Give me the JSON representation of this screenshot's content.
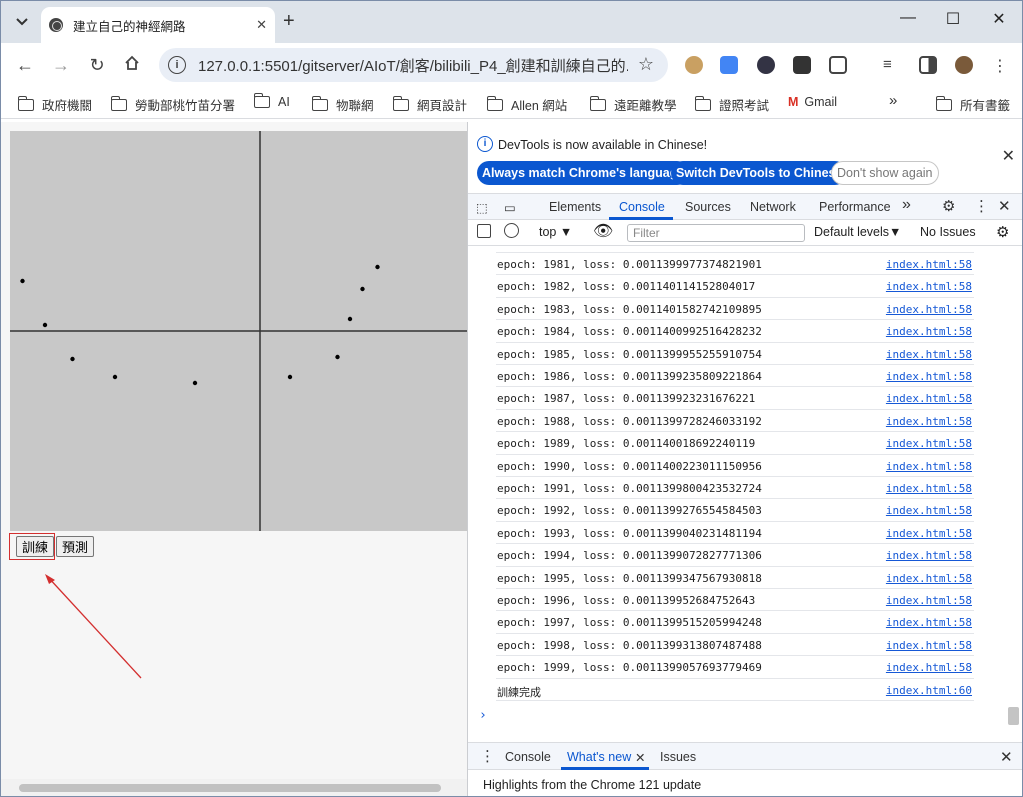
{
  "browser": {
    "tab_title": "建立自己的神經網路",
    "url": "127.0.0.1:5501/gitserver/AIoT/創客/bilibili_P4_創建和訓練自己的...",
    "new_tab": "+",
    "bookmarks": [
      "政府機關",
      "勞動部桃竹苗分署",
      "AI",
      "物聯網",
      "網頁設計",
      "Allen 網站",
      "遠距離教學",
      "證照考試",
      "Gmail",
      "所有書籤"
    ],
    "more": "»"
  },
  "page": {
    "train_button": "訓練",
    "predict_button": "預測"
  },
  "chart_data": {
    "type": "scatter",
    "xlim": [
      -1,
      1
    ],
    "ylim": [
      -1,
      1
    ],
    "grid": false,
    "axes_through_origin": true,
    "x": [
      -0.95,
      -0.86,
      -0.75,
      -0.58,
      -0.26,
      0.12,
      0.31,
      0.36,
      0.41,
      0.47
    ],
    "y": [
      0.25,
      0.03,
      -0.14,
      -0.23,
      -0.26,
      -0.23,
      -0.13,
      0.06,
      0.21,
      0.32
    ]
  },
  "devtools": {
    "info_text": "DevTools is now available in Chinese!",
    "btn_match": "Always match Chrome's language",
    "btn_switch": "Switch DevTools to Chinese",
    "btn_dont": "Don't show again",
    "tabs": [
      "Elements",
      "Console",
      "Sources",
      "Network",
      "Performance"
    ],
    "more_tabs": "»",
    "context": "top",
    "filter_placeholder": "Filter",
    "levels": "Default levels",
    "issues": "No Issues",
    "logs": [
      {
        "text": "epoch: 1981, loss: 0.0011399977374821901",
        "src": "index.html:58"
      },
      {
        "text": "epoch: 1982, loss: 0.001140114152804017",
        "src": "index.html:58"
      },
      {
        "text": "epoch: 1983, loss: 0.0011401582742109895",
        "src": "index.html:58"
      },
      {
        "text": "epoch: 1984, loss: 0.0011400992516428232",
        "src": "index.html:58"
      },
      {
        "text": "epoch: 1985, loss: 0.0011399955255910754",
        "src": "index.html:58"
      },
      {
        "text": "epoch: 1986, loss: 0.0011399235809221864",
        "src": "index.html:58"
      },
      {
        "text": "epoch: 1987, loss: 0.001139923231676221",
        "src": "index.html:58"
      },
      {
        "text": "epoch: 1988, loss: 0.0011399728246033192",
        "src": "index.html:58"
      },
      {
        "text": "epoch: 1989, loss: 0.001140018692240119",
        "src": "index.html:58"
      },
      {
        "text": "epoch: 1990, loss: 0.0011400223011150956",
        "src": "index.html:58"
      },
      {
        "text": "epoch: 1991, loss: 0.0011399800423532724",
        "src": "index.html:58"
      },
      {
        "text": "epoch: 1992, loss: 0.0011399276554584503",
        "src": "index.html:58"
      },
      {
        "text": "epoch: 1993, loss: 0.0011399040231481194",
        "src": "index.html:58"
      },
      {
        "text": "epoch: 1994, loss: 0.0011399072827771306",
        "src": "index.html:58"
      },
      {
        "text": "epoch: 1995, loss: 0.0011399347567930818",
        "src": "index.html:58"
      },
      {
        "text": "epoch: 1996, loss: 0.001139952684752643",
        "src": "index.html:58"
      },
      {
        "text": "epoch: 1997, loss: 0.0011399515205994248",
        "src": "index.html:58"
      },
      {
        "text": "epoch: 1998, loss: 0.0011399313807487488",
        "src": "index.html:58"
      },
      {
        "text": "epoch: 1999, loss: 0.0011399057693779469",
        "src": "index.html:58"
      },
      {
        "text": "訓練完成",
        "src": "index.html:60"
      }
    ],
    "drawer_tabs": [
      "Console",
      "What's new",
      "Issues"
    ],
    "highlights": "Highlights from the Chrome 121 update"
  },
  "colors": {
    "accent": "#0b57d0",
    "arrow": "#d32f2f"
  }
}
